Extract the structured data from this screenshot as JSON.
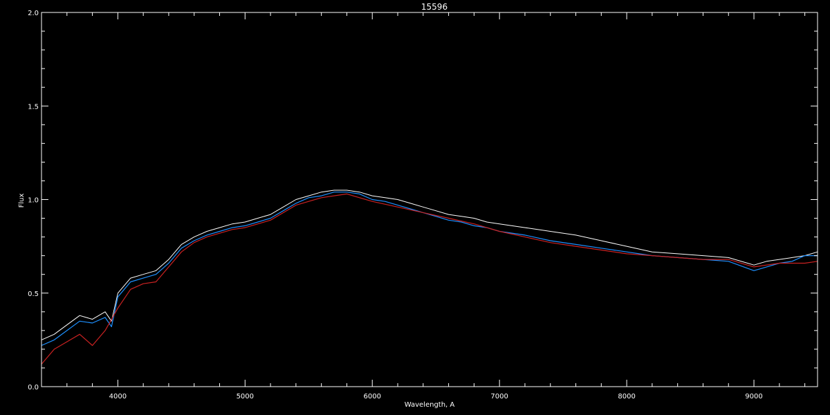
{
  "chart_data": {
    "type": "line",
    "title": "15596",
    "xlabel": "Wavelength, A",
    "ylabel": "Flux",
    "xlim": [
      3400,
      9500
    ],
    "ylim": [
      0.0,
      2.0
    ],
    "xticks": [
      {
        "value": 4000,
        "label": "4000"
      },
      {
        "value": 5000,
        "label": "5000"
      },
      {
        "value": 6000,
        "label": "6000"
      },
      {
        "value": 7000,
        "label": "7000"
      },
      {
        "value": 8000,
        "label": "8000"
      },
      {
        "value": 9000,
        "label": "9000"
      }
    ],
    "yticks": [
      {
        "value": 0.0,
        "label": "0.0"
      },
      {
        "value": 0.5,
        "label": "0.5"
      },
      {
        "value": 1.0,
        "label": "1.0"
      },
      {
        "value": 1.5,
        "label": "1.5"
      },
      {
        "value": 2.0,
        "label": "2.0"
      }
    ],
    "grid": false,
    "legend": "none",
    "colors": {
      "background": "#000000",
      "axes": "#ffffff",
      "error_series": "#ffffff",
      "flux_series": "#1e90ff",
      "model_series": "#cc2222"
    },
    "series": [
      {
        "x": [
          3400,
          3500,
          3600,
          3700,
          3800,
          3900,
          3950,
          4000,
          4100,
          4200,
          4300,
          4400,
          4500,
          4600,
          4700,
          4800,
          4900,
          5000,
          5100,
          5200,
          5300,
          5400,
          5500,
          5600,
          5700,
          5800,
          5900,
          6000,
          6100,
          6200,
          6300,
          6400,
          6500,
          6600,
          6700,
          6800,
          6900,
          7000,
          7200,
          7400,
          7600,
          7800,
          8000,
          8200,
          8400,
          8600,
          8800,
          9000,
          9100,
          9200,
          9300,
          9400,
          9500
        ],
        "y": [
          0.25,
          0.28,
          0.33,
          0.38,
          0.36,
          0.4,
          0.35,
          0.5,
          0.58,
          0.6,
          0.62,
          0.68,
          0.76,
          0.8,
          0.83,
          0.85,
          0.87,
          0.88,
          0.9,
          0.92,
          0.96,
          1.0,
          1.02,
          1.04,
          1.05,
          1.05,
          1.04,
          1.02,
          1.01,
          1.0,
          0.98,
          0.96,
          0.94,
          0.92,
          0.91,
          0.9,
          0.88,
          0.87,
          0.85,
          0.83,
          0.81,
          0.78,
          0.75,
          0.72,
          0.71,
          0.7,
          0.69,
          0.65,
          0.67,
          0.68,
          0.69,
          0.7,
          0.72
        ]
      },
      {
        "x": [
          3400,
          3500,
          3600,
          3700,
          3800,
          3900,
          3950,
          4000,
          4100,
          4200,
          4300,
          4400,
          4500,
          4600,
          4700,
          4800,
          4900,
          5000,
          5100,
          5200,
          5300,
          5400,
          5500,
          5600,
          5700,
          5800,
          5900,
          6000,
          6100,
          6200,
          6300,
          6400,
          6500,
          6600,
          6700,
          6800,
          6900,
          7000,
          7200,
          7400,
          7600,
          7800,
          8000,
          8200,
          8400,
          8600,
          8800,
          9000,
          9100,
          9200,
          9300,
          9400,
          9500
        ],
        "y": [
          0.22,
          0.25,
          0.3,
          0.35,
          0.34,
          0.37,
          0.32,
          0.48,
          0.56,
          0.58,
          0.6,
          0.66,
          0.74,
          0.78,
          0.81,
          0.83,
          0.85,
          0.86,
          0.88,
          0.9,
          0.94,
          0.98,
          1.01,
          1.02,
          1.04,
          1.04,
          1.03,
          1.0,
          0.99,
          0.97,
          0.95,
          0.93,
          0.91,
          0.89,
          0.88,
          0.86,
          0.85,
          0.83,
          0.81,
          0.78,
          0.76,
          0.74,
          0.72,
          0.7,
          0.69,
          0.68,
          0.67,
          0.62,
          0.64,
          0.66,
          0.67,
          0.7,
          0.7
        ]
      },
      {
        "x": [
          3400,
          3500,
          3600,
          3700,
          3800,
          3900,
          4000,
          4100,
          4200,
          4300,
          4400,
          4500,
          4600,
          4700,
          4800,
          4900,
          5000,
          5200,
          5400,
          5600,
          5800,
          6000,
          6200,
          6400,
          6600,
          6800,
          7000,
          7200,
          7400,
          7600,
          7800,
          8000,
          8200,
          8400,
          8600,
          8800,
          9000,
          9200,
          9400,
          9500
        ],
        "y": [
          0.12,
          0.2,
          0.24,
          0.28,
          0.22,
          0.3,
          0.42,
          0.52,
          0.55,
          0.56,
          0.64,
          0.72,
          0.77,
          0.8,
          0.82,
          0.84,
          0.85,
          0.89,
          0.97,
          1.01,
          1.03,
          0.99,
          0.96,
          0.93,
          0.9,
          0.87,
          0.83,
          0.8,
          0.77,
          0.75,
          0.73,
          0.71,
          0.7,
          0.69,
          0.68,
          0.68,
          0.64,
          0.66,
          0.66,
          0.67
        ]
      }
    ]
  }
}
